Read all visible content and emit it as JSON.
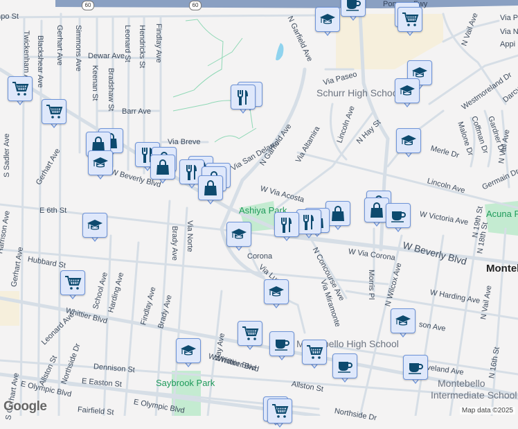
{
  "map": {
    "freeway_shield": "60",
    "attribution": "Map data ©2025",
    "logo": "Google",
    "labels": [
      "Campo St",
      "Twickenham Ave",
      "Blackshear Ave",
      "Gerhart Ave",
      "Simmons Ave",
      "Dewar Ave",
      "Keenan St",
      "Bradshaw St",
      "Leonard St",
      "Hendricks St",
      "Findlay Ave",
      "Barr Ave",
      "Via Breve",
      "Via San Delarro",
      "S Sadler Ave",
      "Gerhart Ave",
      "W Beverly Blvd",
      "N Garfield Ave",
      "N Garfield Ave",
      "Via Paseo",
      "Schurr High School",
      "Lincoln Ave",
      "N Hay St",
      "Via Altamira",
      "W Via Acosta",
      "Merle Dr",
      "Lincoln Ave",
      "Westmoreland Dr",
      "N Vail Ave",
      "Malone Dr",
      "Coffman Dr",
      "Gardner Dr",
      "N Vail Ave",
      "Germain Dr",
      "Darcy",
      "Via P",
      "Via N",
      "Appi",
      "Pomona Fwy",
      "Ashiya Park",
      "W Victoria Ave",
      "N 19th St",
      "Acuna Park",
      "E 6th St",
      "W Beverly Blvd",
      "W Via Corona",
      "Corona",
      "N Concourse Ave",
      "Via Lunes",
      "Via Miramonte",
      "Morris Pl",
      "N Wilcox Ave",
      "N 18th St",
      "Montebello",
      "W Harding Ave",
      "N Vail Ave",
      "son Ave",
      "Montebello High School",
      "Cleveland Ave",
      "N 16th St",
      "Montebello",
      "Intermediate School",
      "W Whittier Blvd",
      "Allston St",
      "Northside Dr",
      "Hubbard St",
      "Gerhart Ave",
      "Harrison Ave",
      "School Ave",
      "Harding Ave",
      "Findlay Ave",
      "Brady Ave",
      "Brady Ave",
      "Via Norte",
      "Whittier Blvd",
      "Leonard Ave",
      "S Gerhart Ave",
      "Allston St",
      "Northside Dr",
      "Dennison St",
      "E Easton St",
      "E Olympic Blvd",
      "E Olympic Blvd",
      "Fairfield St",
      "Saybrook Park",
      "Hay Ave",
      "Whittier Blvd"
    ],
    "markers": [
      "cart",
      "cart",
      "shop",
      "shop",
      "school",
      "restaurant",
      "shop",
      "shop",
      "restaurant",
      "restaurant",
      "shop",
      "shop",
      "shop",
      "restaurant",
      "restaurant",
      "school",
      "cafe",
      "cart",
      "cart",
      "school",
      "school",
      "school",
      "shop",
      "shop",
      "cafe",
      "shop",
      "shop",
      "restaurant",
      "restaurant",
      "school",
      "school",
      "cart",
      "school",
      "school",
      "cart",
      "cafe",
      "cart",
      "cafe",
      "cafe",
      "school",
      "cart",
      "cart"
    ]
  },
  "colors": {
    "pin_fill": "#dfe8fb",
    "pin_border": "#6d93d8",
    "icon": "#0d4a6e",
    "park": "#bfe8cd",
    "road": "#d6dee6",
    "freeway": "#8aa0c2"
  }
}
